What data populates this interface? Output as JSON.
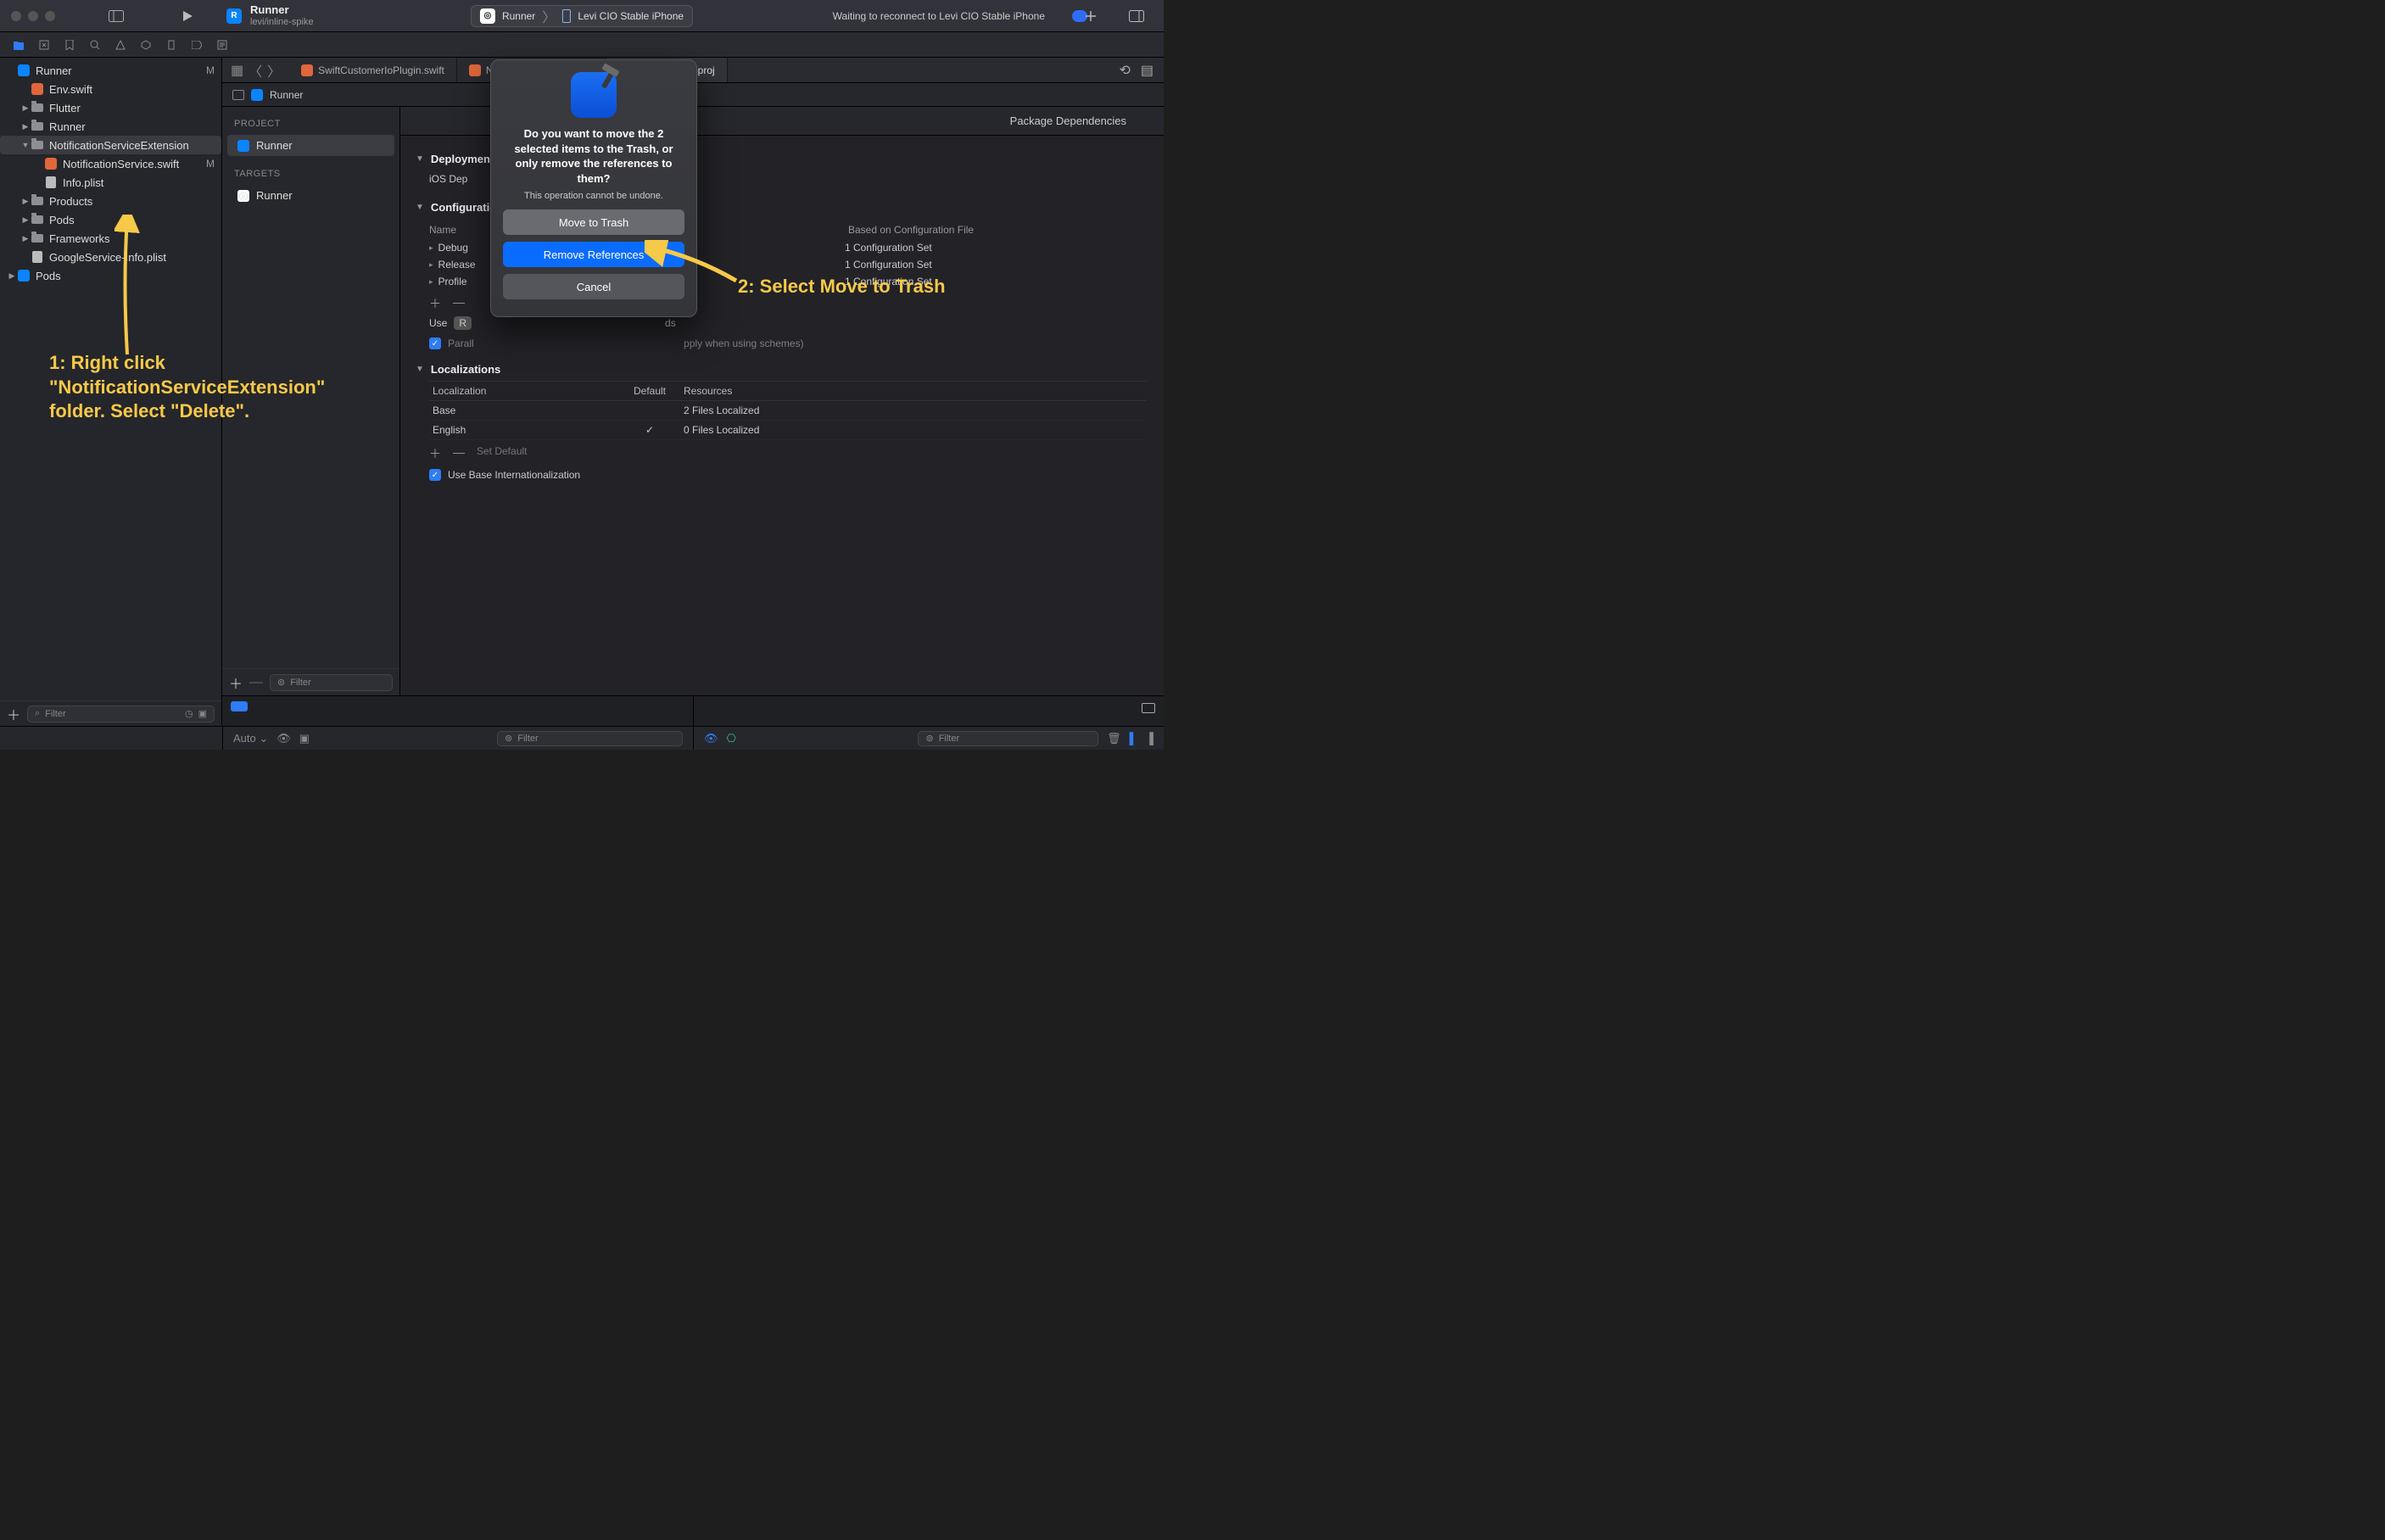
{
  "titlebar": {
    "title": "Runner",
    "subtitle": "levi/inline-spike",
    "scheme_app": "Runner",
    "scheme_device": "Levi CIO Stable iPhone",
    "status": "Waiting to reconnect to Levi CIO Stable iPhone"
  },
  "tabs": [
    {
      "label": "SwiftCustomerIoPlugin.swift",
      "kind": "swift"
    },
    {
      "label": "NotificationService.swift",
      "kind": "swift"
    },
    {
      "label": "Runner.xcodeproj",
      "kind": "proj",
      "active": true
    }
  ],
  "breadcrumb": {
    "item": "Runner"
  },
  "tree": [
    {
      "d": 0,
      "icon": "proj",
      "label": "Runner",
      "mod": "M",
      "open": true
    },
    {
      "d": 1,
      "icon": "swift",
      "label": "Env.swift"
    },
    {
      "d": 1,
      "icon": "folder",
      "label": "Flutter",
      "open": false,
      "arrow": ">"
    },
    {
      "d": 1,
      "icon": "folder",
      "label": "Runner",
      "open": false,
      "arrow": ">"
    },
    {
      "d": 1,
      "icon": "folder",
      "label": "NotificationServiceExtension",
      "open": true,
      "arrow": "v",
      "sel": true
    },
    {
      "d": 2,
      "icon": "swift",
      "label": "NotificationService.swift",
      "mod": "M"
    },
    {
      "d": 2,
      "icon": "plist",
      "label": "Info.plist"
    },
    {
      "d": 1,
      "icon": "folder",
      "label": "Products",
      "arrow": ">"
    },
    {
      "d": 1,
      "icon": "folder",
      "label": "Pods",
      "arrow": ">"
    },
    {
      "d": 1,
      "icon": "folder",
      "label": "Frameworks",
      "arrow": ">"
    },
    {
      "d": 1,
      "icon": "plist",
      "label": "GoogleService-Info.plist"
    },
    {
      "d": 0,
      "icon": "proj",
      "label": "Pods",
      "arrow": ">"
    }
  ],
  "sidebar": {
    "filter_placeholder": "Filter"
  },
  "outline": {
    "project_header": "PROJECT",
    "project_item": "Runner",
    "targets_header": "TARGETS",
    "target_item": "Runner",
    "filter_placeholder": "Filter"
  },
  "settings_tabs": {
    "pkg_deps": "Package Dependencies"
  },
  "deployment": {
    "head": "Deployment",
    "key": "iOS Dep"
  },
  "configurations": {
    "head": "Configurations",
    "col_name": "Name",
    "col_based": "Based on Configuration File",
    "rows": [
      {
        "name": "Debug",
        "based": "1 Configuration Set"
      },
      {
        "name": "Release",
        "based": "1 Configuration Set"
      },
      {
        "name": "Profile",
        "based": "1 Configuration Set"
      }
    ],
    "use_label": "Use",
    "r_badge": "R",
    "parallelize_suffix": "ds",
    "parallelize_label": "Parallelize build for command-line builds (does not apply when using schemes)"
  },
  "localizations": {
    "head": "Localizations",
    "col_loc": "Localization",
    "col_def": "Default",
    "col_res": "Resources",
    "rows": [
      {
        "loc": "Base",
        "def": "",
        "res": "2 Files Localized"
      },
      {
        "loc": "English",
        "def": "✓",
        "res": "0 Files Localized"
      }
    ],
    "set_default": "Set Default",
    "use_base": "Use Base Internationalization"
  },
  "modal": {
    "heading": "Do you want to move the 2 selected items to the Trash, or only remove the references to them?",
    "subtext": "This operation cannot be undone.",
    "move": "Move to Trash",
    "remove": "Remove References",
    "cancel": "Cancel"
  },
  "annotations": {
    "step1": "1: Right click \"NotificationServiceExtension\" folder. Select \"Delete\".",
    "step2": "2: Select Move to Trash"
  },
  "statusbar": {
    "auto": "Auto ⌄",
    "filter_placeholder": "Filter"
  }
}
